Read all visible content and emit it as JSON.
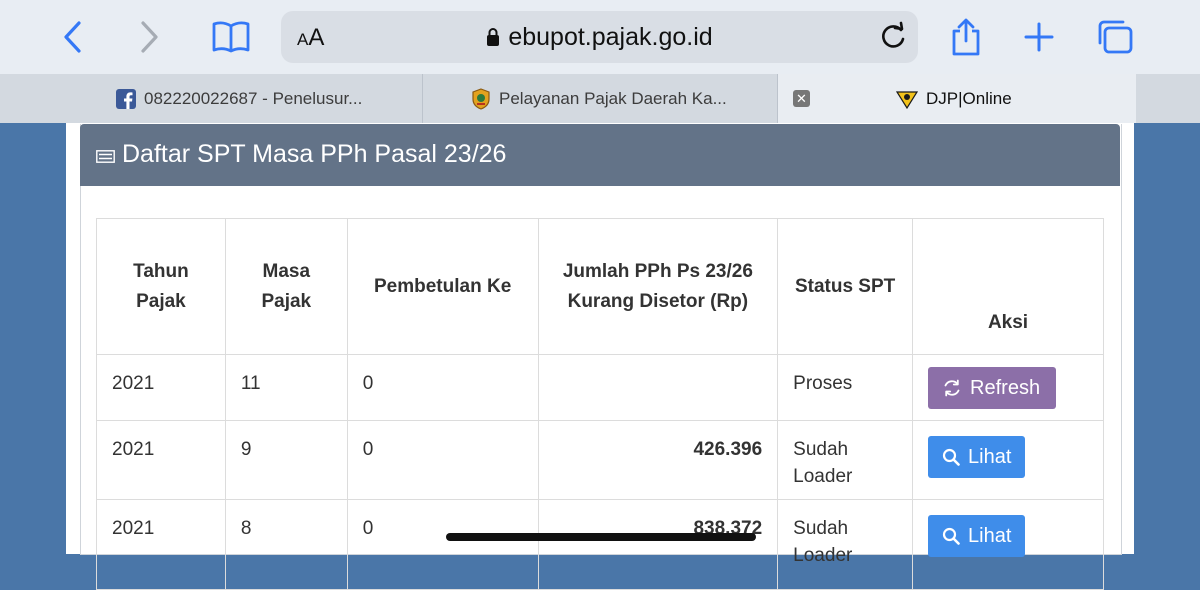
{
  "browser": {
    "text_size_label_small": "A",
    "text_size_label_large": "A",
    "url": "ebupot.pajak.go.id",
    "tabs": [
      {
        "label": "082220022687 - Penelusur...",
        "icon": "facebook-icon"
      },
      {
        "label": "Pelayanan Pajak Daerah Ka...",
        "icon": "regional-emblem-icon"
      },
      {
        "label": "DJP|Online",
        "icon": "djp-logo-icon",
        "active": true
      }
    ],
    "colors": {
      "toolbar": "#e8edf3",
      "accent": "#3478f6"
    }
  },
  "panel": {
    "title": "Daftar SPT Masa PPh Pasal 23/26",
    "header_color": "#637388"
  },
  "table": {
    "columns": [
      "Tahun Pajak",
      "Masa Pajak",
      "Pembetulan Ke",
      "Jumlah PPh Ps 23/26 Kurang Disetor (Rp)",
      "Status SPT",
      "Aksi"
    ],
    "rows": [
      {
        "tahun": "2021",
        "masa": "11",
        "pembetulan": "0",
        "jumlah": "",
        "status": "Proses",
        "aksi": "Refresh"
      },
      {
        "tahun": "2021",
        "masa": "9",
        "pembetulan": "0",
        "jumlah": "426.396",
        "status": "Sudah Loader",
        "aksi": "Lihat"
      },
      {
        "tahun": "2021",
        "masa": "8",
        "pembetulan": "0",
        "jumlah": "838.372",
        "status": "Sudah Loader",
        "aksi": "Lihat"
      }
    ],
    "button_colors": {
      "refresh": "#8c6fa8",
      "lihat": "#3f8dea"
    }
  }
}
